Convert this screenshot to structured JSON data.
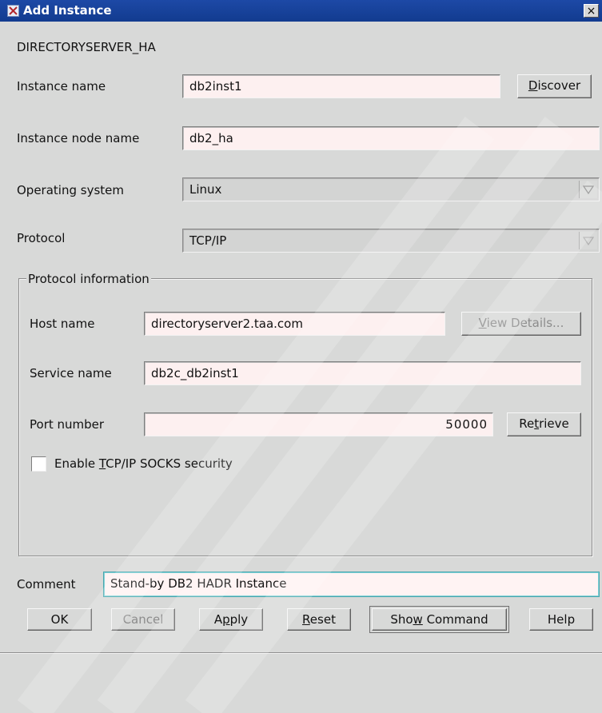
{
  "window": {
    "title": "Add Instance",
    "close_glyph": "×"
  },
  "header": {
    "object_name": "DIRECTORYSERVER_HA"
  },
  "instance_name": {
    "label": "Instance name",
    "value": "db2inst1"
  },
  "discover_button": {
    "pre": "",
    "mn": "D",
    "post": "iscover"
  },
  "instance_node_name": {
    "label": "Instance node name",
    "value": "db2_ha"
  },
  "operating_system": {
    "label": "Operating system",
    "value": "Linux"
  },
  "protocol": {
    "label": "Protocol",
    "value": "TCP/IP"
  },
  "protocol_info": {
    "legend": "Protocol information",
    "host_name": {
      "label": "Host name",
      "value": "directoryserver2.taa.com"
    },
    "view_details_button": {
      "pre": "",
      "mn": "V",
      "post": "iew Details..."
    },
    "service_name": {
      "label": "Service name",
      "value": "db2c_db2inst1"
    },
    "port_number": {
      "label": "Port number",
      "value": "50000"
    },
    "retrieve_button": {
      "pre": "Re",
      "mn": "t",
      "post": "rieve"
    },
    "socks_checkbox": {
      "pre": "Enable ",
      "mn": "T",
      "post": "CP/IP SOCKS security",
      "checked": false
    }
  },
  "comment": {
    "label": "Comment",
    "value": "Stand-by DB2 HADR Instance"
  },
  "buttons": {
    "ok": "OK",
    "cancel": "Cancel",
    "apply": {
      "pre": "A",
      "mn": "p",
      "post": "ply"
    },
    "reset": {
      "pre": "",
      "mn": "R",
      "post": "eset"
    },
    "show_command": {
      "pre": "Sho",
      "mn": "w",
      "post": " Command"
    },
    "help": "Help"
  },
  "icons": {
    "window_icon": "app-icon",
    "combo_arrow": "triangle-down-icon"
  },
  "colors": {
    "titlebar": "#1d49a6",
    "field_background": "#fdf0f0",
    "focus_border": "#4ba6ae"
  }
}
